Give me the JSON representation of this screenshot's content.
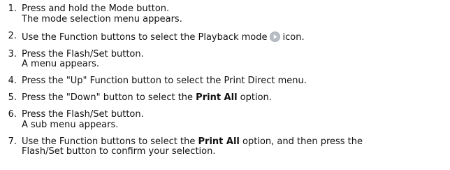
{
  "steps": [
    {
      "number": "1.",
      "lines": [
        {
          "text": "Press and hold the Mode button."
        },
        {
          "text": "The mode selection menu appears."
        }
      ]
    },
    {
      "number": "2.",
      "lines": [
        {
          "before": "Use the Function buttons to select the Playback mode",
          "icon": "playback-mode-icon",
          "after": "icon."
        }
      ]
    },
    {
      "number": "3.",
      "lines": [
        {
          "text": "Press the Flash/Set button."
        },
        {
          "text": "A menu appears."
        }
      ]
    },
    {
      "number": "4.",
      "lines": [
        {
          "text": "Press the \"Up\" Function button to select the Print Direct menu."
        }
      ]
    },
    {
      "number": "5.",
      "lines": [
        {
          "before": "Press the \"Down\" button to select the ",
          "bold": "Print All",
          "after": " option."
        }
      ]
    },
    {
      "number": "6.",
      "lines": [
        {
          "text": "Press the Flash/Set button."
        },
        {
          "text": "A sub menu appears."
        }
      ]
    },
    {
      "number": "7.",
      "lines": [
        {
          "before": "Use the Function buttons to select the ",
          "bold": "Print All",
          "after": " option, and then press the"
        },
        {
          "text": "Flash/Set button to confirm your selection."
        }
      ]
    }
  ],
  "icon_color": "#b8bcc4"
}
